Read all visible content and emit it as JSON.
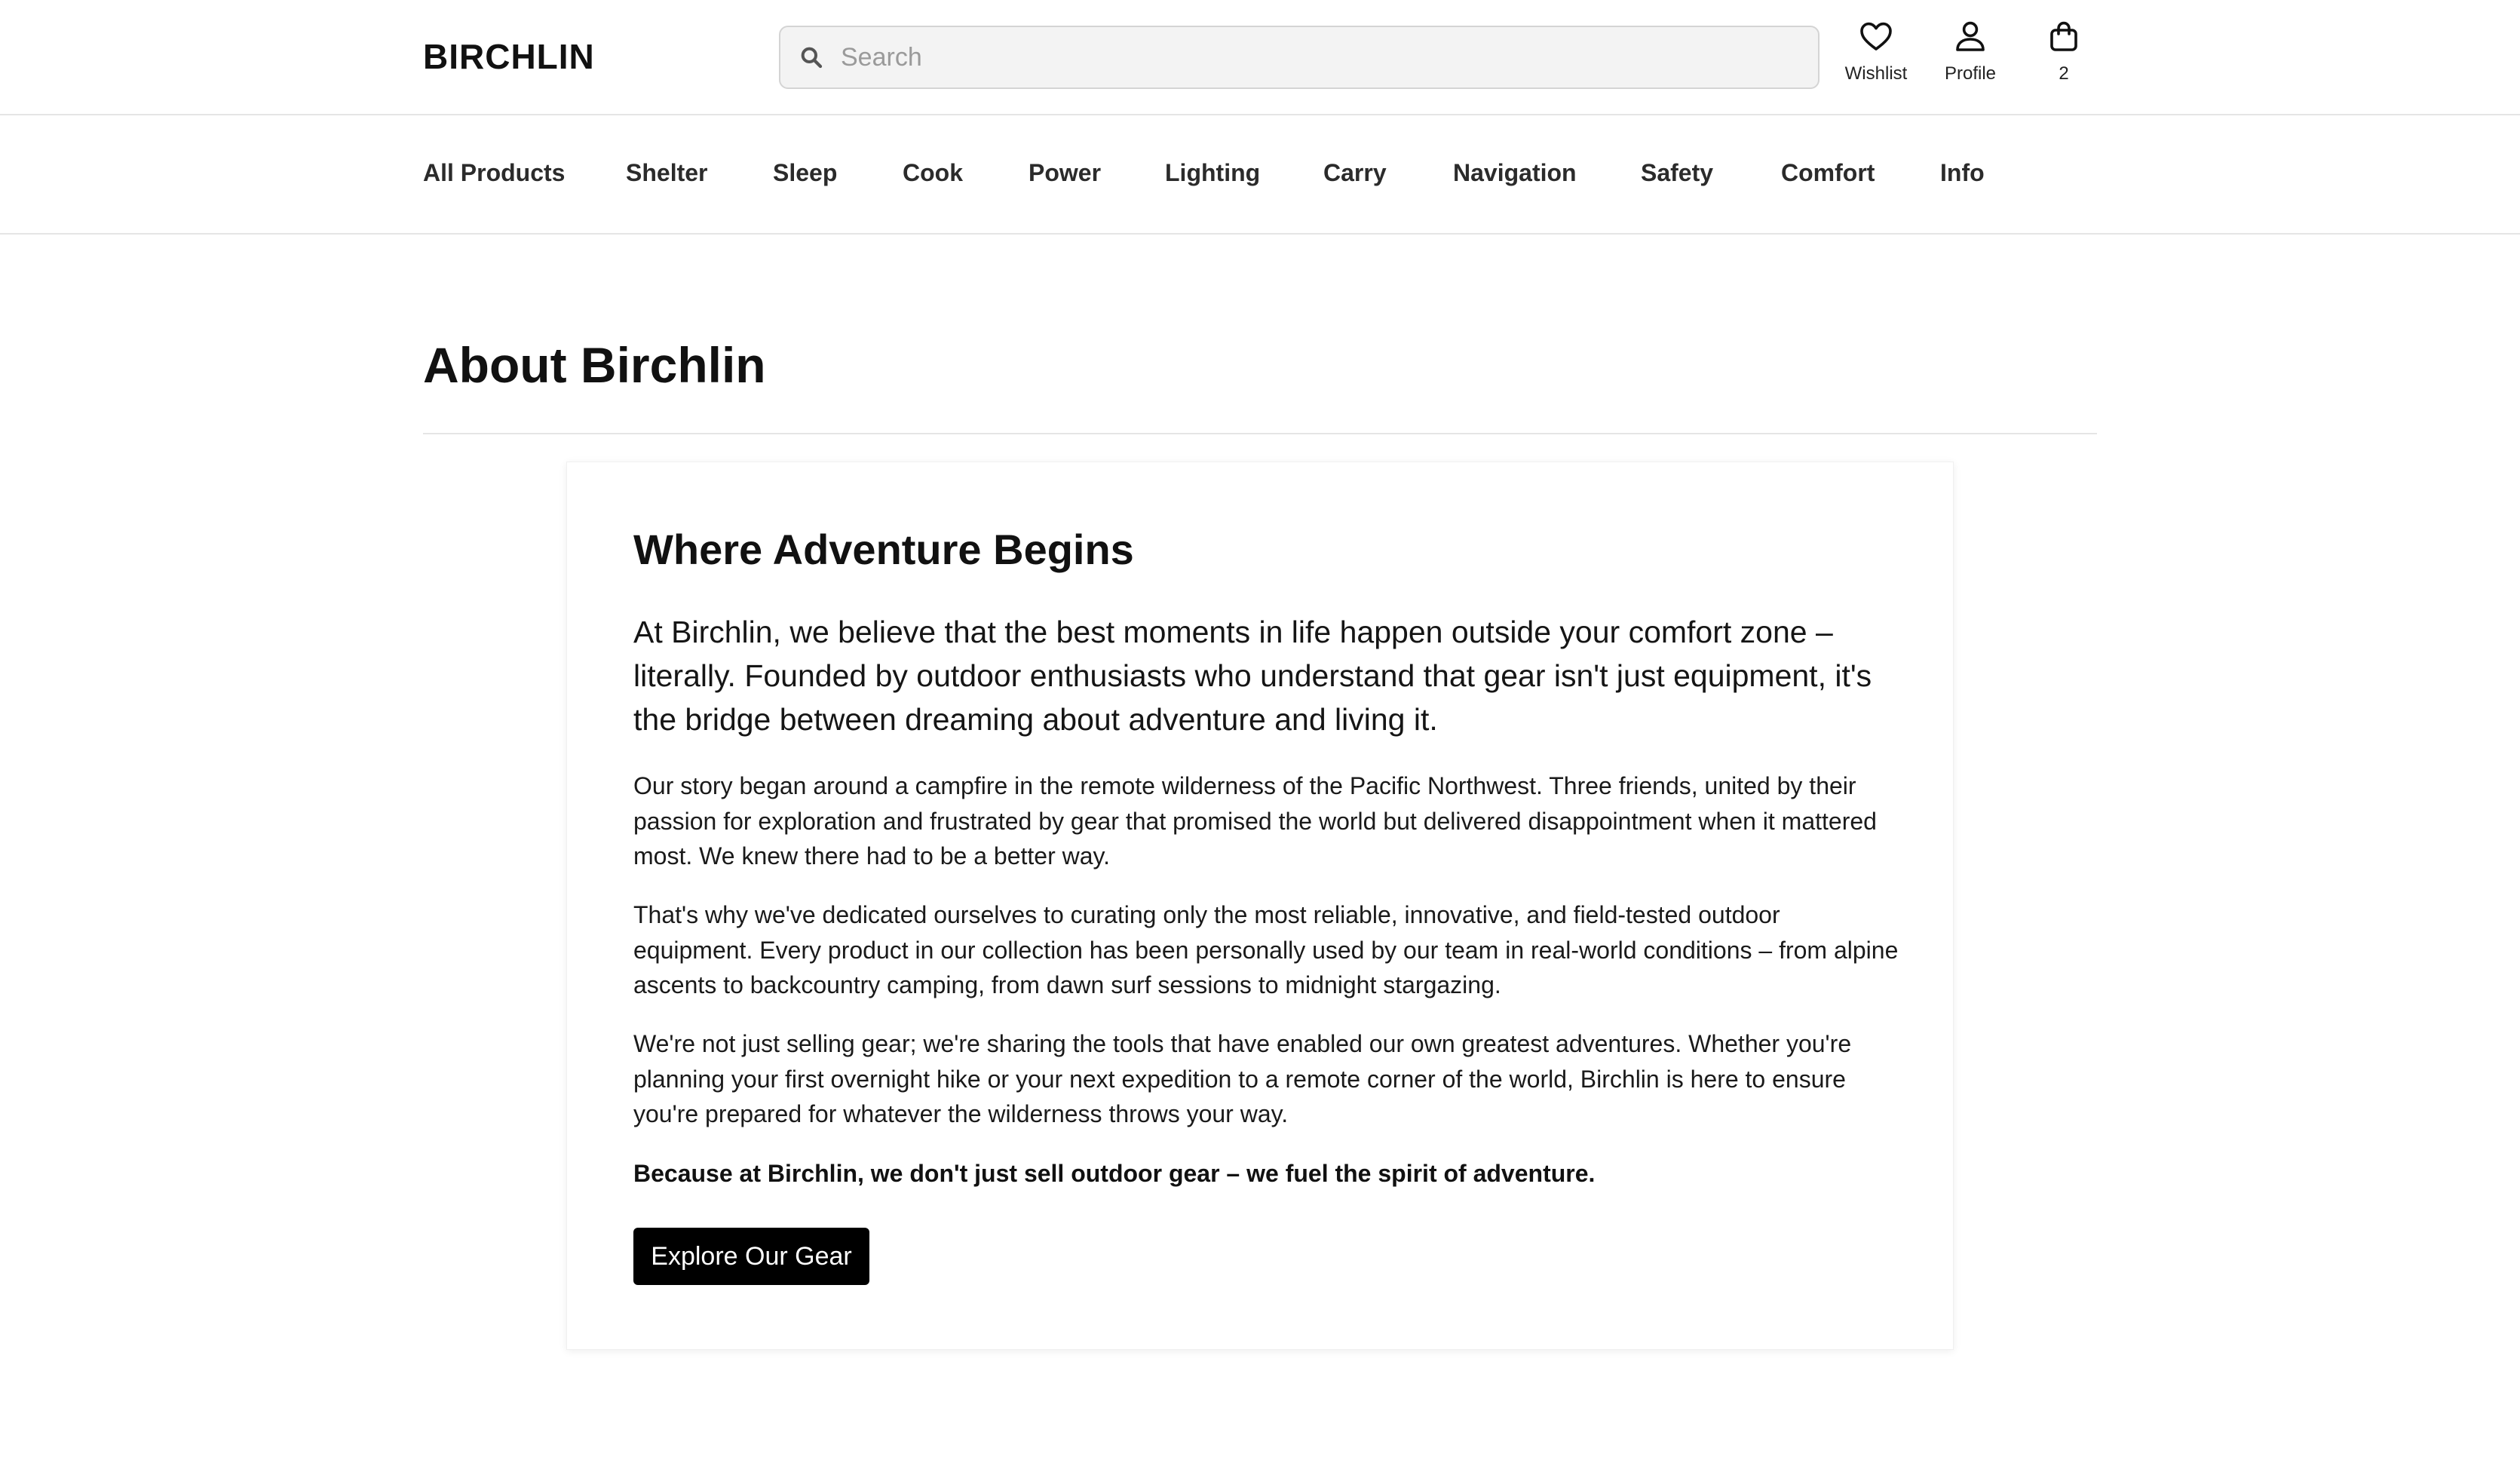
{
  "header": {
    "logo": "BIRCHLIN",
    "search": {
      "placeholder": "Search",
      "value": ""
    },
    "actions": {
      "wishlist_label": "Wishlist",
      "profile_label": "Profile",
      "cart_count": "2"
    }
  },
  "nav": {
    "items": [
      "All Products",
      "Shelter",
      "Sleep",
      "Cook",
      "Power",
      "Lighting",
      "Carry",
      "Navigation",
      "Safety",
      "Comfort",
      "Info"
    ]
  },
  "page": {
    "title": "About Birchlin"
  },
  "card": {
    "heading": "Where Adventure Begins",
    "lead": "At Birchlin, we believe that the best moments in life happen outside your comfort zone – literally. Founded by outdoor enthusiasts who understand that gear isn't just equipment, it's the bridge between dreaming about adventure and living it.",
    "paragraphs": [
      "Our story began around a campfire in the remote wilderness of the Pacific Northwest. Three friends, united by their passion for exploration and frustrated by gear that promised the world but delivered disappointment when it mattered most. We knew there had to be a better way.",
      "That's why we've dedicated ourselves to curating only the most reliable, innovative, and field-tested outdoor equipment. Every product in our collection has been personally used by our team in real-world conditions – from alpine ascents to backcountry camping, from dawn surf sessions to midnight stargazing.",
      "We're not just selling gear; we're sharing the tools that have enabled our own greatest adventures. Whether you're planning your first overnight hike or your next expedition to a remote corner of the world, Birchlin is here to ensure you're prepared for whatever the wilderness throws your way."
    ],
    "tagline": "Because at Birchlin, we don't just sell outdoor gear – we fuel the spirit of adventure.",
    "cta_label": "Explore Our Gear"
  },
  "icons": {
    "search": "search-icon",
    "wishlist": "heart-icon",
    "profile": "user-icon",
    "cart": "shopping-bag-icon"
  },
  "colors": {
    "text": "#111111",
    "cta_background": "#000000",
    "cta_text": "#ffffff",
    "search_background": "#f3f3f3",
    "divider": "#e5e5e5"
  }
}
